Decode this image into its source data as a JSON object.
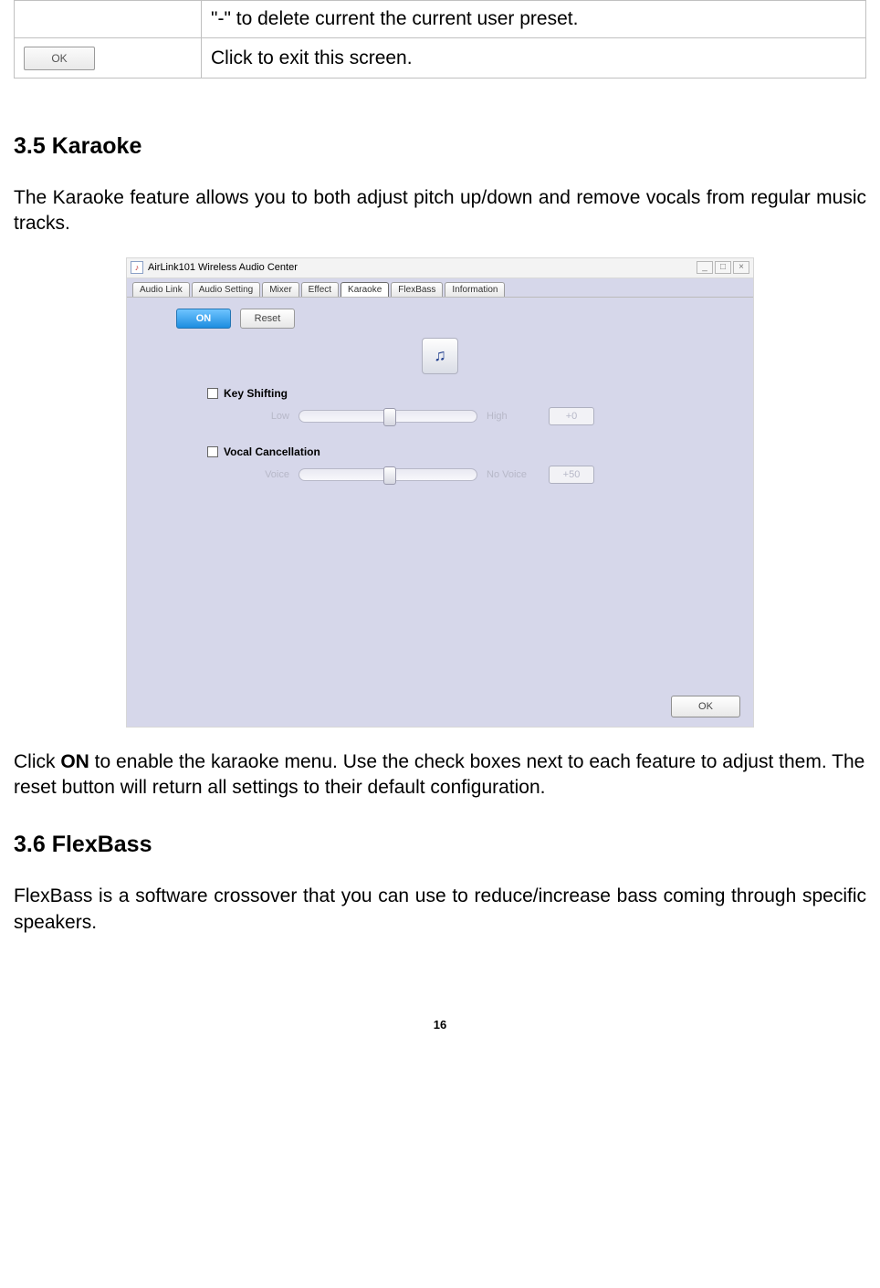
{
  "topTable": {
    "row1_right": "\"-\" to delete current the current user preset.",
    "row2_left_btn": "OK",
    "row2_right": "Click to exit this screen."
  },
  "section35": {
    "heading": "3.5 Karaoke",
    "intro": "The Karaoke feature allows you to both adjust pitch up/down and remove vocals from regular music tracks.",
    "afterShot1": "Click ",
    "afterShotBold": "ON",
    "afterShot2": " to enable the karaoke menu.  Use the check boxes next to each feature to adjust them.  The reset button will return all settings to their default configuration."
  },
  "section36": {
    "heading": "3.6 FlexBass",
    "intro": "FlexBass is a software crossover that you can use to reduce/increase bass coming through specific speakers."
  },
  "pageNumber": "16",
  "window": {
    "title": "AirLink101 Wireless Audio Center",
    "tabs": [
      "Audio Link",
      "Audio Setting",
      "Mixer",
      "Effect",
      "Karaoke",
      "FlexBass",
      "Information"
    ],
    "activeTab": "Karaoke",
    "onBtn": "ON",
    "resetBtn": "Reset",
    "group1": {
      "title": "Key Shifting",
      "leftLabel": "Low",
      "rightLabel": "High",
      "value": "+0"
    },
    "group2": {
      "title": "Vocal Cancellation",
      "leftLabel": "Voice",
      "rightLabel": "No Voice",
      "value": "+50"
    },
    "footerOk": "OK"
  }
}
